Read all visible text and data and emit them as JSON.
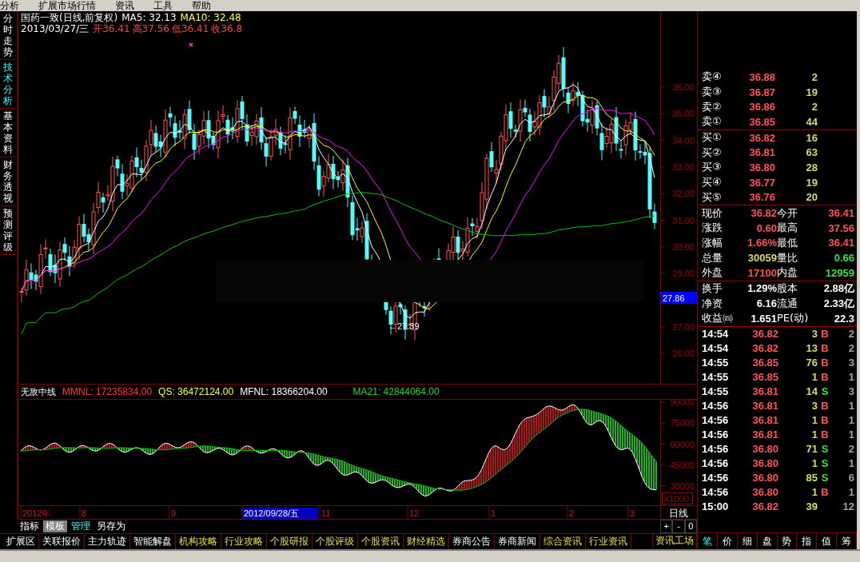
{
  "menu": [
    {
      "label": "分析"
    },
    {
      "label": "扩展市场行情"
    },
    {
      "label": "资讯"
    },
    {
      "label": "工具"
    },
    {
      "label": "帮助"
    }
  ],
  "side_tabs": [
    {
      "label": "分时走势",
      "selected": false
    },
    {
      "label": "技术分析",
      "selected": true
    },
    {
      "label": "基本资料",
      "selected": false
    },
    {
      "label": "财务透视",
      "selected": false
    },
    {
      "label": "预测评级",
      "selected": false
    }
  ],
  "chart_header": {
    "title": "国药一致(日线,前复权)",
    "ma5": "MA5: 32.13",
    "ma10": "MA10: 32.48",
    "date": "2013/03/27/三",
    "quote": [
      "开36.41",
      "高37.56",
      "低36.41",
      "收36.8"
    ]
  },
  "price_axis": {
    "ticks": [
      "36.00",
      "35.00",
      "34.00",
      "33.00",
      "32.00",
      "31.00",
      "30.00",
      "29.00",
      "27.00",
      "26.00"
    ],
    "current": "27.86",
    "low_marker": "←27.39"
  },
  "indicator": {
    "name": "无敌中线",
    "values": [
      {
        "label": "MMNL: 17235834.00",
        "color": "#ff3030"
      },
      {
        "label": "QS: 36472124.00",
        "color": "#ffff40"
      },
      {
        "label": "MFNL: 18366204.00",
        "color": "#ffffff"
      },
      {
        "label": "MA21: 42844064.00",
        "color": "#30d030"
      }
    ]
  },
  "indicator_axis": {
    "ticks": [
      "90000",
      "75000",
      "60000",
      "45000",
      "30000"
    ],
    "unit": "X1000"
  },
  "date_axis": {
    "labels": [
      {
        "label": "2012年",
        "selected": false
      },
      {
        "label": "8",
        "selected": false
      },
      {
        "label": "9",
        "selected": false
      },
      {
        "label": "2012/09/28/五",
        "selected": true
      },
      {
        "label": "11",
        "selected": false
      },
      {
        "label": "12",
        "selected": false
      },
      {
        "label": "1",
        "selected": false
      },
      {
        "label": "2",
        "selected": false
      },
      {
        "label": "3",
        "selected": false
      }
    ],
    "period": "日线"
  },
  "zoom_buttons": [
    "+",
    "-",
    "0"
  ],
  "formula_tabs": [
    {
      "label": "指标",
      "selected": false,
      "highlighted": false
    },
    {
      "label": "模板",
      "selected": true,
      "highlighted": false
    },
    {
      "label": "管理",
      "selected": false,
      "highlighted": true
    },
    {
      "label": "另存为",
      "selected": false,
      "highlighted": false
    }
  ],
  "toolbar": [
    {
      "label": "扩展区",
      "highlighted": false
    },
    {
      "label": "关联报价",
      "highlighted": false
    },
    {
      "label": "主力轨迹",
      "highlighted": false
    },
    {
      "label": "智能解盘",
      "highlighted": false
    },
    {
      "label": "机构攻略",
      "highlighted": true
    },
    {
      "label": "行业攻略",
      "highlighted": true
    },
    {
      "label": "个股研报",
      "highlighted": true
    },
    {
      "label": "个股评级",
      "highlighted": true
    },
    {
      "label": "个股资讯",
      "highlighted": true
    },
    {
      "label": "财经精选",
      "highlighted": true
    },
    {
      "label": "券商公告",
      "highlighted": false
    },
    {
      "label": "券商新闻",
      "highlighted": false
    },
    {
      "label": "综合资讯",
      "highlighted": true
    },
    {
      "label": "行业资讯",
      "highlighted": true
    }
  ],
  "info_button": "资讯工场",
  "order_book": {
    "asks": [
      {
        "label": "卖④",
        "price": "36.88",
        "volume": "2"
      },
      {
        "label": "卖③",
        "price": "36.87",
        "volume": "19"
      },
      {
        "label": "卖②",
        "price": "36.86",
        "volume": "2"
      },
      {
        "label": "卖①",
        "price": "36.85",
        "volume": "44"
      }
    ],
    "bids": [
      {
        "label": "买①",
        "price": "36.82",
        "volume": "16"
      },
      {
        "label": "买②",
        "price": "36.81",
        "volume": "63"
      },
      {
        "label": "买③",
        "price": "36.80",
        "volume": "28"
      },
      {
        "label": "买④",
        "price": "36.77",
        "volume": "19"
      },
      {
        "label": "买⑤",
        "price": "36.76",
        "volume": "20"
      }
    ]
  },
  "quote_stats": [
    {
      "label": "现价",
      "value": "36.82",
      "color": "#ff5454"
    },
    {
      "label": "今开",
      "value": "36.41",
      "color": "#ff5454"
    },
    {
      "label": "涨跌",
      "value": "0.60",
      "color": "#ff5454"
    },
    {
      "label": "最高",
      "value": "37.56",
      "color": "#ff5454"
    },
    {
      "label": "涨幅",
      "value": "1.66%",
      "color": "#ff5454"
    },
    {
      "label": "最低",
      "value": "36.41",
      "color": "#ff5454"
    },
    {
      "label": "总量",
      "value": "30059",
      "color": "#d8d870"
    },
    {
      "label": "量比",
      "value": "0.66",
      "color": "#40e040"
    },
    {
      "label": "外盘",
      "value": "17100",
      "color": "#ff5454"
    },
    {
      "label": "内盘",
      "value": "12959",
      "color": "#40e040"
    }
  ],
  "fundamentals": [
    {
      "label": "换手",
      "value": "1.29%"
    },
    {
      "label": "股本",
      "value": "2.88亿"
    },
    {
      "label": "净资",
      "value": "6.16"
    },
    {
      "label": "流通",
      "value": "2.33亿"
    },
    {
      "label": "收益㈣",
      "value": "1.651"
    },
    {
      "label": "PE(动)",
      "value": "22.3"
    }
  ],
  "trades": [
    {
      "time": "14:54",
      "price": "36.82",
      "volume": "3",
      "side": "B",
      "count": "2"
    },
    {
      "time": "14:54",
      "price": "36.82",
      "volume": "13",
      "side": "B",
      "count": "2"
    },
    {
      "time": "14:55",
      "price": "36.85",
      "volume": "76",
      "side": "B",
      "count": "3"
    },
    {
      "time": "14:55",
      "price": "36.85",
      "volume": "1",
      "side": "B",
      "count": "1"
    },
    {
      "time": "14:55",
      "price": "36.81",
      "volume": "14",
      "side": "S",
      "count": "3"
    },
    {
      "time": "14:56",
      "price": "36.81",
      "volume": "3",
      "side": "B",
      "count": "1"
    },
    {
      "time": "14:56",
      "price": "36.81",
      "volume": "1",
      "side": "B",
      "count": "1"
    },
    {
      "time": "14:56",
      "price": "36.81",
      "volume": "1",
      "side": "B",
      "count": "1"
    },
    {
      "time": "14:56",
      "price": "36.80",
      "volume": "71",
      "side": "S",
      "count": "2"
    },
    {
      "time": "14:56",
      "price": "36.80",
      "volume": "1",
      "side": "S",
      "count": "1"
    },
    {
      "time": "14:56",
      "price": "36.80",
      "volume": "85",
      "side": "S",
      "count": "6"
    },
    {
      "time": "14:56",
      "price": "36.80",
      "volume": "1",
      "side": "B",
      "count": "1"
    },
    {
      "time": "15:00",
      "price": "36.82",
      "volume": "39",
      "count": "12"
    }
  ],
  "detail_tabs": [
    {
      "label": "笔",
      "selected": true
    },
    {
      "label": "价",
      "selected": false
    },
    {
      "label": "细",
      "selected": false
    },
    {
      "label": "盘",
      "selected": false
    },
    {
      "label": "势",
      "selected": false
    },
    {
      "label": "指",
      "selected": false
    },
    {
      "label": "值",
      "selected": false
    },
    {
      "label": "筹",
      "selected": false
    }
  ]
}
